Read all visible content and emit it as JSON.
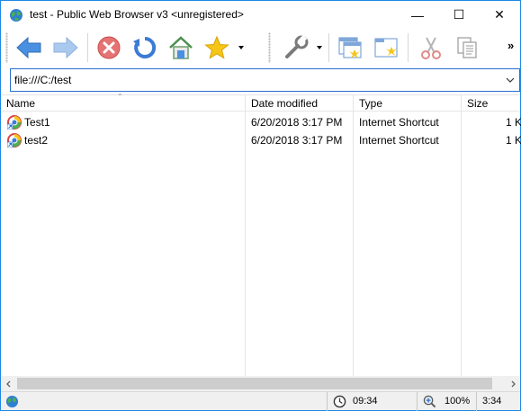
{
  "window": {
    "title": "test - Public Web Browser v3 <unregistered>",
    "minimize_glyph": "—",
    "maximize_glyph": "☐",
    "close_glyph": "✕"
  },
  "toolbar": {
    "buttons": [
      {
        "name": "back",
        "icon": "back-arrow-icon",
        "color": "#4a90e2"
      },
      {
        "name": "forward",
        "icon": "forward-arrow-icon",
        "color": "#a9c9ef"
      },
      {
        "name": "stop",
        "icon": "stop-icon",
        "color": "#e06060"
      },
      {
        "name": "refresh",
        "icon": "refresh-icon",
        "color": "#3a7bd5"
      },
      {
        "name": "home",
        "icon": "home-icon",
        "color": "#5aa05a"
      },
      {
        "name": "favorites",
        "icon": "star-icon",
        "color": "#f5c518"
      },
      {
        "name": "tools",
        "icon": "wrench-icon",
        "color": "#888888"
      },
      {
        "name": "new-window",
        "icon": "new-window-icon",
        "color": "#7fa7d9"
      },
      {
        "name": "new-tab",
        "icon": "new-tab-icon",
        "color": "#7fa7d9"
      },
      {
        "name": "cut",
        "icon": "scissors-icon",
        "color": "#d08080"
      },
      {
        "name": "copy",
        "icon": "copy-icon",
        "color": "#999999"
      }
    ],
    "more_glyph": "»"
  },
  "address": {
    "value": "file:///C:/test"
  },
  "list": {
    "columns": [
      "Name",
      "Date modified",
      "Type",
      "Size"
    ],
    "rows": [
      {
        "name": "Test1",
        "date": "6/20/2018 3:17 PM",
        "type": "Internet Shortcut",
        "size": "1 K"
      },
      {
        "name": "test2",
        "date": "6/20/2018 3:17 PM",
        "type": "Internet Shortcut",
        "size": "1 K"
      }
    ]
  },
  "status": {
    "clock_icon": "clock-icon",
    "time_left": "09:34",
    "zoom_icon": "zoom-icon",
    "zoom": "100%",
    "time_right": "3:34"
  },
  "colors": {
    "accent": "#2a6fcf",
    "window_border": "#1e88e5"
  }
}
